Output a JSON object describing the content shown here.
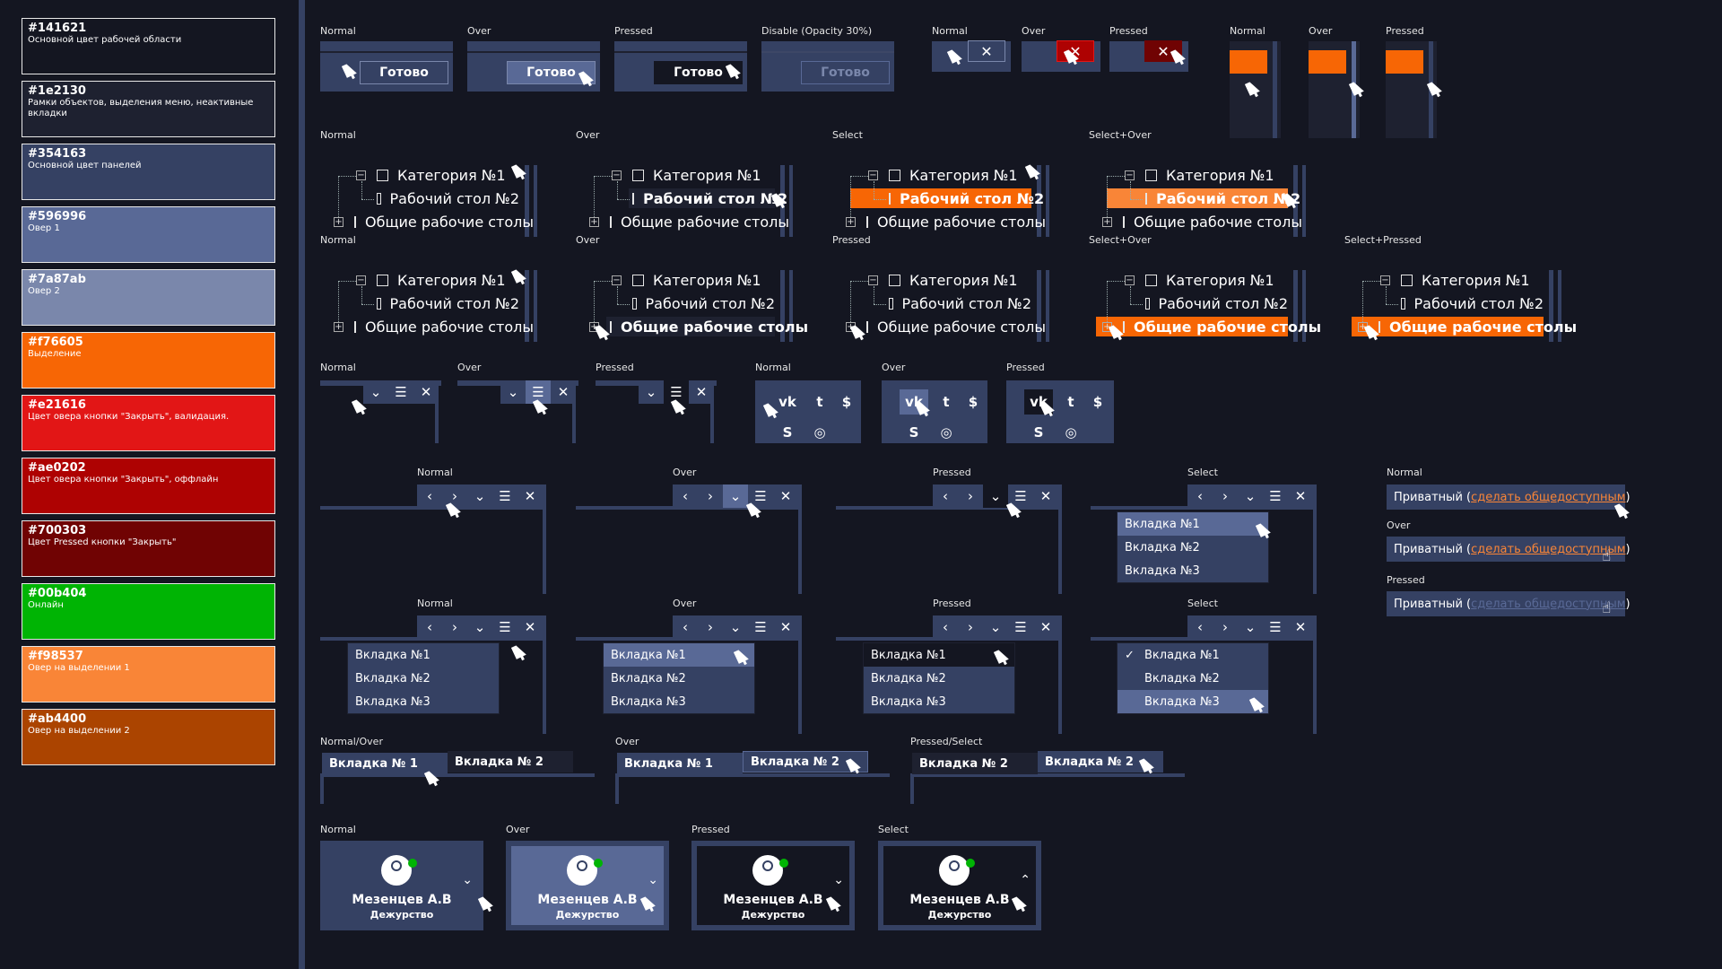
{
  "palette": [
    {
      "hex": "#141621",
      "desc": "Основной цвет рабочей области",
      "bg": "#141621"
    },
    {
      "hex": "#1e2130",
      "desc": "Рамки объектов, выделения меню, неактивные вкладки",
      "bg": "#1e2130"
    },
    {
      "hex": "#354163",
      "desc": "Основной цвет панелей",
      "bg": "#354163"
    },
    {
      "hex": "#596996",
      "desc": "Овер 1",
      "bg": "#596996"
    },
    {
      "hex": "#7a87ab",
      "desc": "Овер 2",
      "bg": "#7a87ab"
    },
    {
      "hex": "#f76605",
      "desc": "Выделение",
      "bg": "#f76605"
    },
    {
      "hex": "#e21616",
      "desc": "Цвет овера кнопки \"Закрыть\", валидация.",
      "bg": "#e21616"
    },
    {
      "hex": "#ae0202",
      "desc": "Цвет овера кнопки \"Закрыть\", оффлайн",
      "bg": "#ae0202"
    },
    {
      "hex": "#700303",
      "desc": "Цвет Pressed кнопки \"Закрыть\"",
      "bg": "#700303"
    },
    {
      "hex": "#00b404",
      "desc": "Онлайн",
      "bg": "#00b404"
    },
    {
      "hex": "#f98537",
      "desc": "Овер на выделении 1",
      "bg": "#f98537"
    },
    {
      "hex": "#ab4400",
      "desc": "Овер на выделении 2",
      "bg": "#ab4400"
    }
  ],
  "states": {
    "normal": "Normal",
    "over": "Over",
    "pressed": "Pressed",
    "disable": "Disable (Opacity 30%)",
    "select": "Select",
    "select_over": "Select+Over",
    "select_pressed": "Select+Pressed",
    "normal_over": "Normal/Over",
    "pressed_select": "Pressed/Select"
  },
  "buttons": {
    "done": "Готово"
  },
  "tree": {
    "cat1": "Категория №1",
    "desk2": "Рабочий стол №2",
    "shared": "Общие рабочие столы"
  },
  "tabs": {
    "tab1": "Вкладка №1",
    "tab2": "Вкладка №2",
    "tab3": "Вкладка №3",
    "tab_sp1": "Вкладка № 1",
    "tab_sp2": "Вкладка № 2"
  },
  "user": {
    "name": "Мезенцев А.В",
    "role": "Дежурство",
    "online_color": "#00b404"
  },
  "privacy": {
    "prefix": "Приватный (",
    "link": "сделать общедоступным",
    "suffix": ")"
  },
  "social": {
    "vk": "vk-icon",
    "twitter": "twitter-icon",
    "skype": "skype-icon",
    "github": "github-icon"
  },
  "colors": {
    "accent": "#f76605",
    "close_over": "#e21616",
    "close_pressed": "#700303",
    "panel": "#354163"
  }
}
